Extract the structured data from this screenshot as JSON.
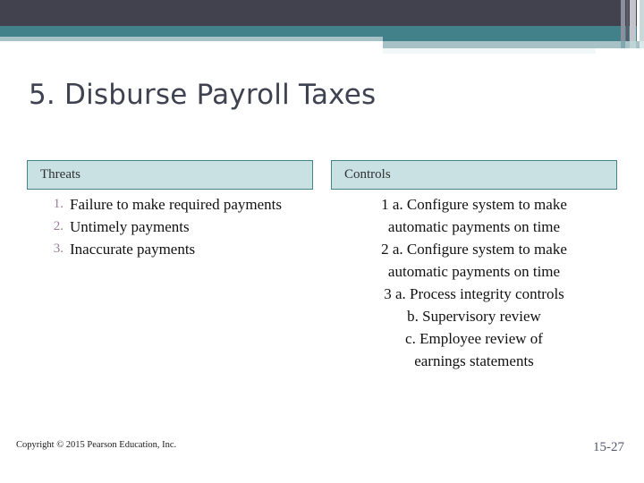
{
  "header": {
    "colors": {
      "dark_navy": "#42424f",
      "teal": "#42808a",
      "light_blue_grey": "#a6c2c6",
      "faint": "#f2f7f8"
    }
  },
  "title": "5. Disburse Payroll Taxes",
  "table": {
    "columns": [
      {
        "key": "threats",
        "label": "Threats"
      },
      {
        "key": "controls",
        "label": "Controls"
      }
    ],
    "threats": [
      "Failure to make required payments",
      "Untimely payments",
      "Inaccurate payments"
    ],
    "controls": [
      "1 a. Configure system to make",
      "automatic payments on time",
      "2 a. Configure system to make",
      "automatic payments on time",
      "3 a. Process integrity controls",
      "b. Supervisory review",
      "c.  Employee review of",
      "earnings statements"
    ],
    "number_color": "#9a7d99",
    "header_fill": "#c9e1e3",
    "header_border": "#43818b"
  },
  "footer": {
    "copyright": "Copyright © 2015 Pearson Education, Inc.",
    "page_number": "15-27"
  }
}
